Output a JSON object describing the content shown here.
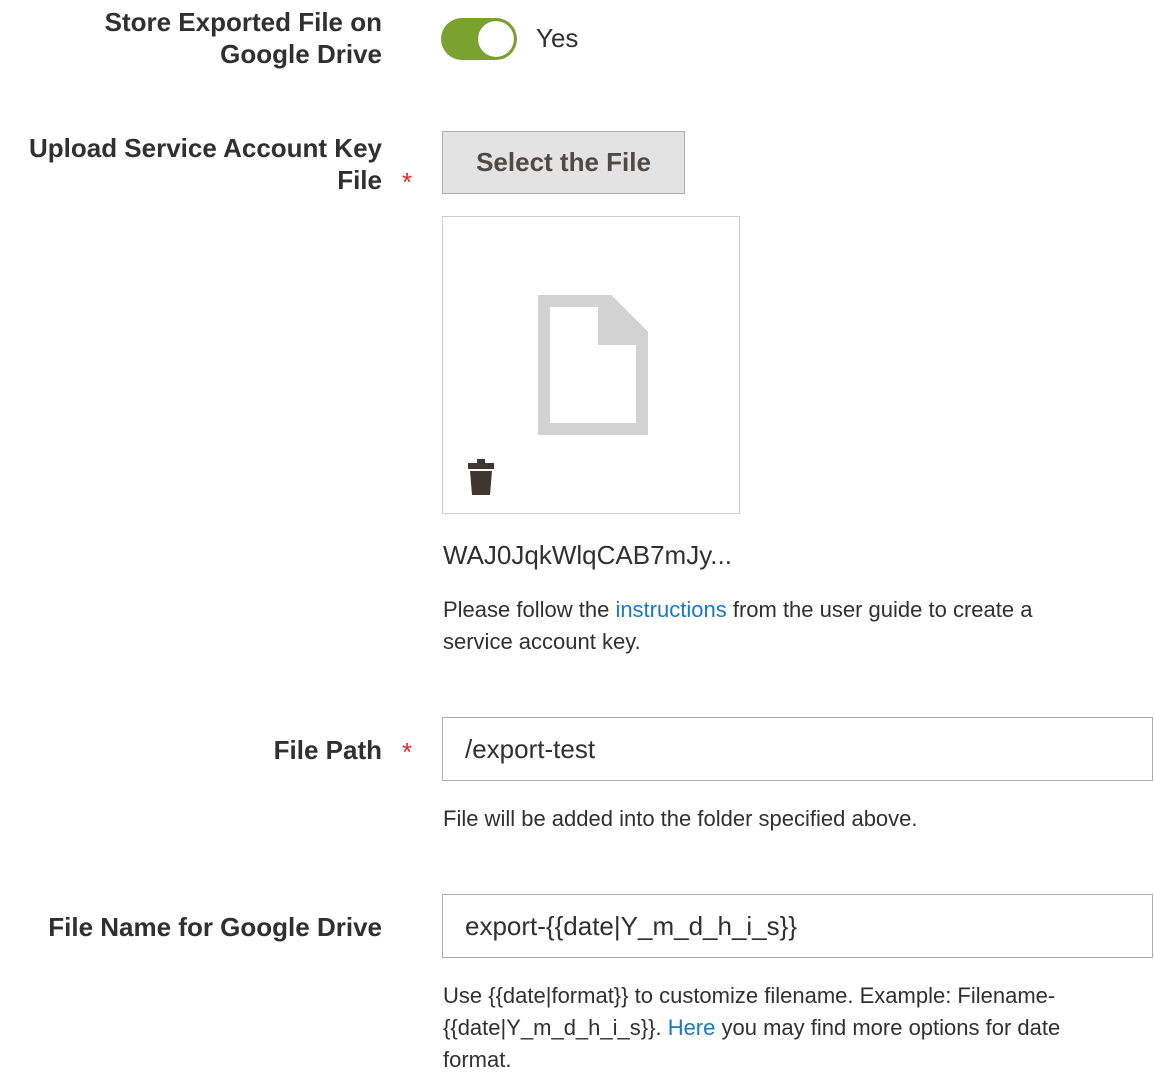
{
  "store_on_drive": {
    "label_line1": "Store Exported File on",
    "label_line2": "Google Drive",
    "toggle_state": "on",
    "toggle_text": "Yes",
    "toggle_color": "#79a22e"
  },
  "upload_key": {
    "label_line1": "Upload Service Account Key",
    "label_line2": "File",
    "required_mark": "*",
    "button_label": "Select the File",
    "preview_icon": "document-icon",
    "delete_icon": "trash-icon",
    "file_name": "WAJ0JqkWlqCAB7mJy...",
    "note_before": "Please follow the ",
    "note_link": "instructions",
    "note_after_line1": " from the user guide to create a",
    "note_line2": "service account key."
  },
  "file_path": {
    "label": "File Path",
    "required_mark": "*",
    "value": "/export-test",
    "note": "File will be added into the folder specified above."
  },
  "file_name": {
    "label": "File Name for Google Drive",
    "value": "export-{{date|Y_m_d_h_i_s}}",
    "note_line1": "Use {{date|format}} to customize filename. Example: Filename-",
    "note_line2_before": "{{date|Y_m_d_h_i_s}}. ",
    "note_link": "Here",
    "note_line2_after": " you may find more options for date",
    "note_line3": "format."
  },
  "colors": {
    "required": "#e22626",
    "link": "#1979c3",
    "toggle_on": "#79a22e"
  }
}
